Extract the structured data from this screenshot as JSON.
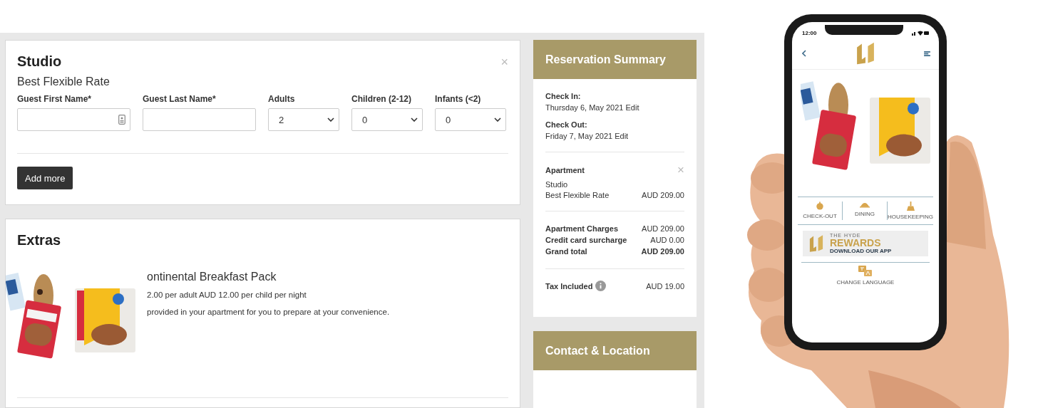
{
  "room": {
    "title": "Studio",
    "close": "×",
    "rate": "Best Flexible Rate",
    "fields": [
      {
        "label": "Guest First Name*",
        "kind": "text",
        "autofill_icon": true
      },
      {
        "label": "Guest Last Name*",
        "kind": "text",
        "autofill_icon": false
      },
      {
        "label": "Adults",
        "kind": "select",
        "value": "2"
      },
      {
        "label": "Children (2-12)",
        "kind": "select",
        "value": "0"
      },
      {
        "label": "Infants (<2)",
        "kind": "select",
        "value": "0"
      }
    ],
    "add_button": "Add more"
  },
  "extras": {
    "title": "Extras",
    "items": [
      {
        "kind": "picture",
        "name": "ontinental Breakfast Pack",
        "price": "2.00 per adult AUD 12.00 per child per night",
        "description": "provided in your apartment for you to prepare at your convenience."
      }
    ]
  },
  "summary": {
    "title": "Reservation Summary",
    "dates": [
      {
        "label": "Check In:",
        "date": "Thursday 6, May 2021",
        "action": "Edit"
      },
      {
        "label": "Check Out:",
        "date": "Friday 7, May 2021",
        "action": "Edit"
      }
    ],
    "apartment": {
      "label": "Apartment",
      "remove": "×",
      "room": "Studio",
      "rate": "Best Flexible Rate",
      "price": "AUD 209.00"
    },
    "totals": [
      {
        "label": "Apartment Charges",
        "amount": "AUD 209.00",
        "emphasis": false
      },
      {
        "label": "Credit card surcharge",
        "amount": "AUD 0.00",
        "emphasis": false
      },
      {
        "label": "Grand total",
        "amount": "AUD 209.00",
        "emphasis": true
      }
    ],
    "tax": {
      "label": "Tax Included",
      "amount": "AUD 19.00"
    }
  },
  "contact": {
    "title": "Contact & Location"
  },
  "phone_app": {
    "time": "12:00",
    "services": [
      {
        "label": "CHECK-OUT",
        "kind": "bell"
      },
      {
        "label": "DINING",
        "kind": "cloche"
      },
      {
        "label": "HOUSEKEEPING",
        "kind": "broom"
      }
    ],
    "rewards": {
      "brand": "THE HYDE",
      "title": "REWARDS",
      "subtitle": "DOWNLOAD OUR APP"
    },
    "language": "CHANGE LANGUAGE"
  }
}
